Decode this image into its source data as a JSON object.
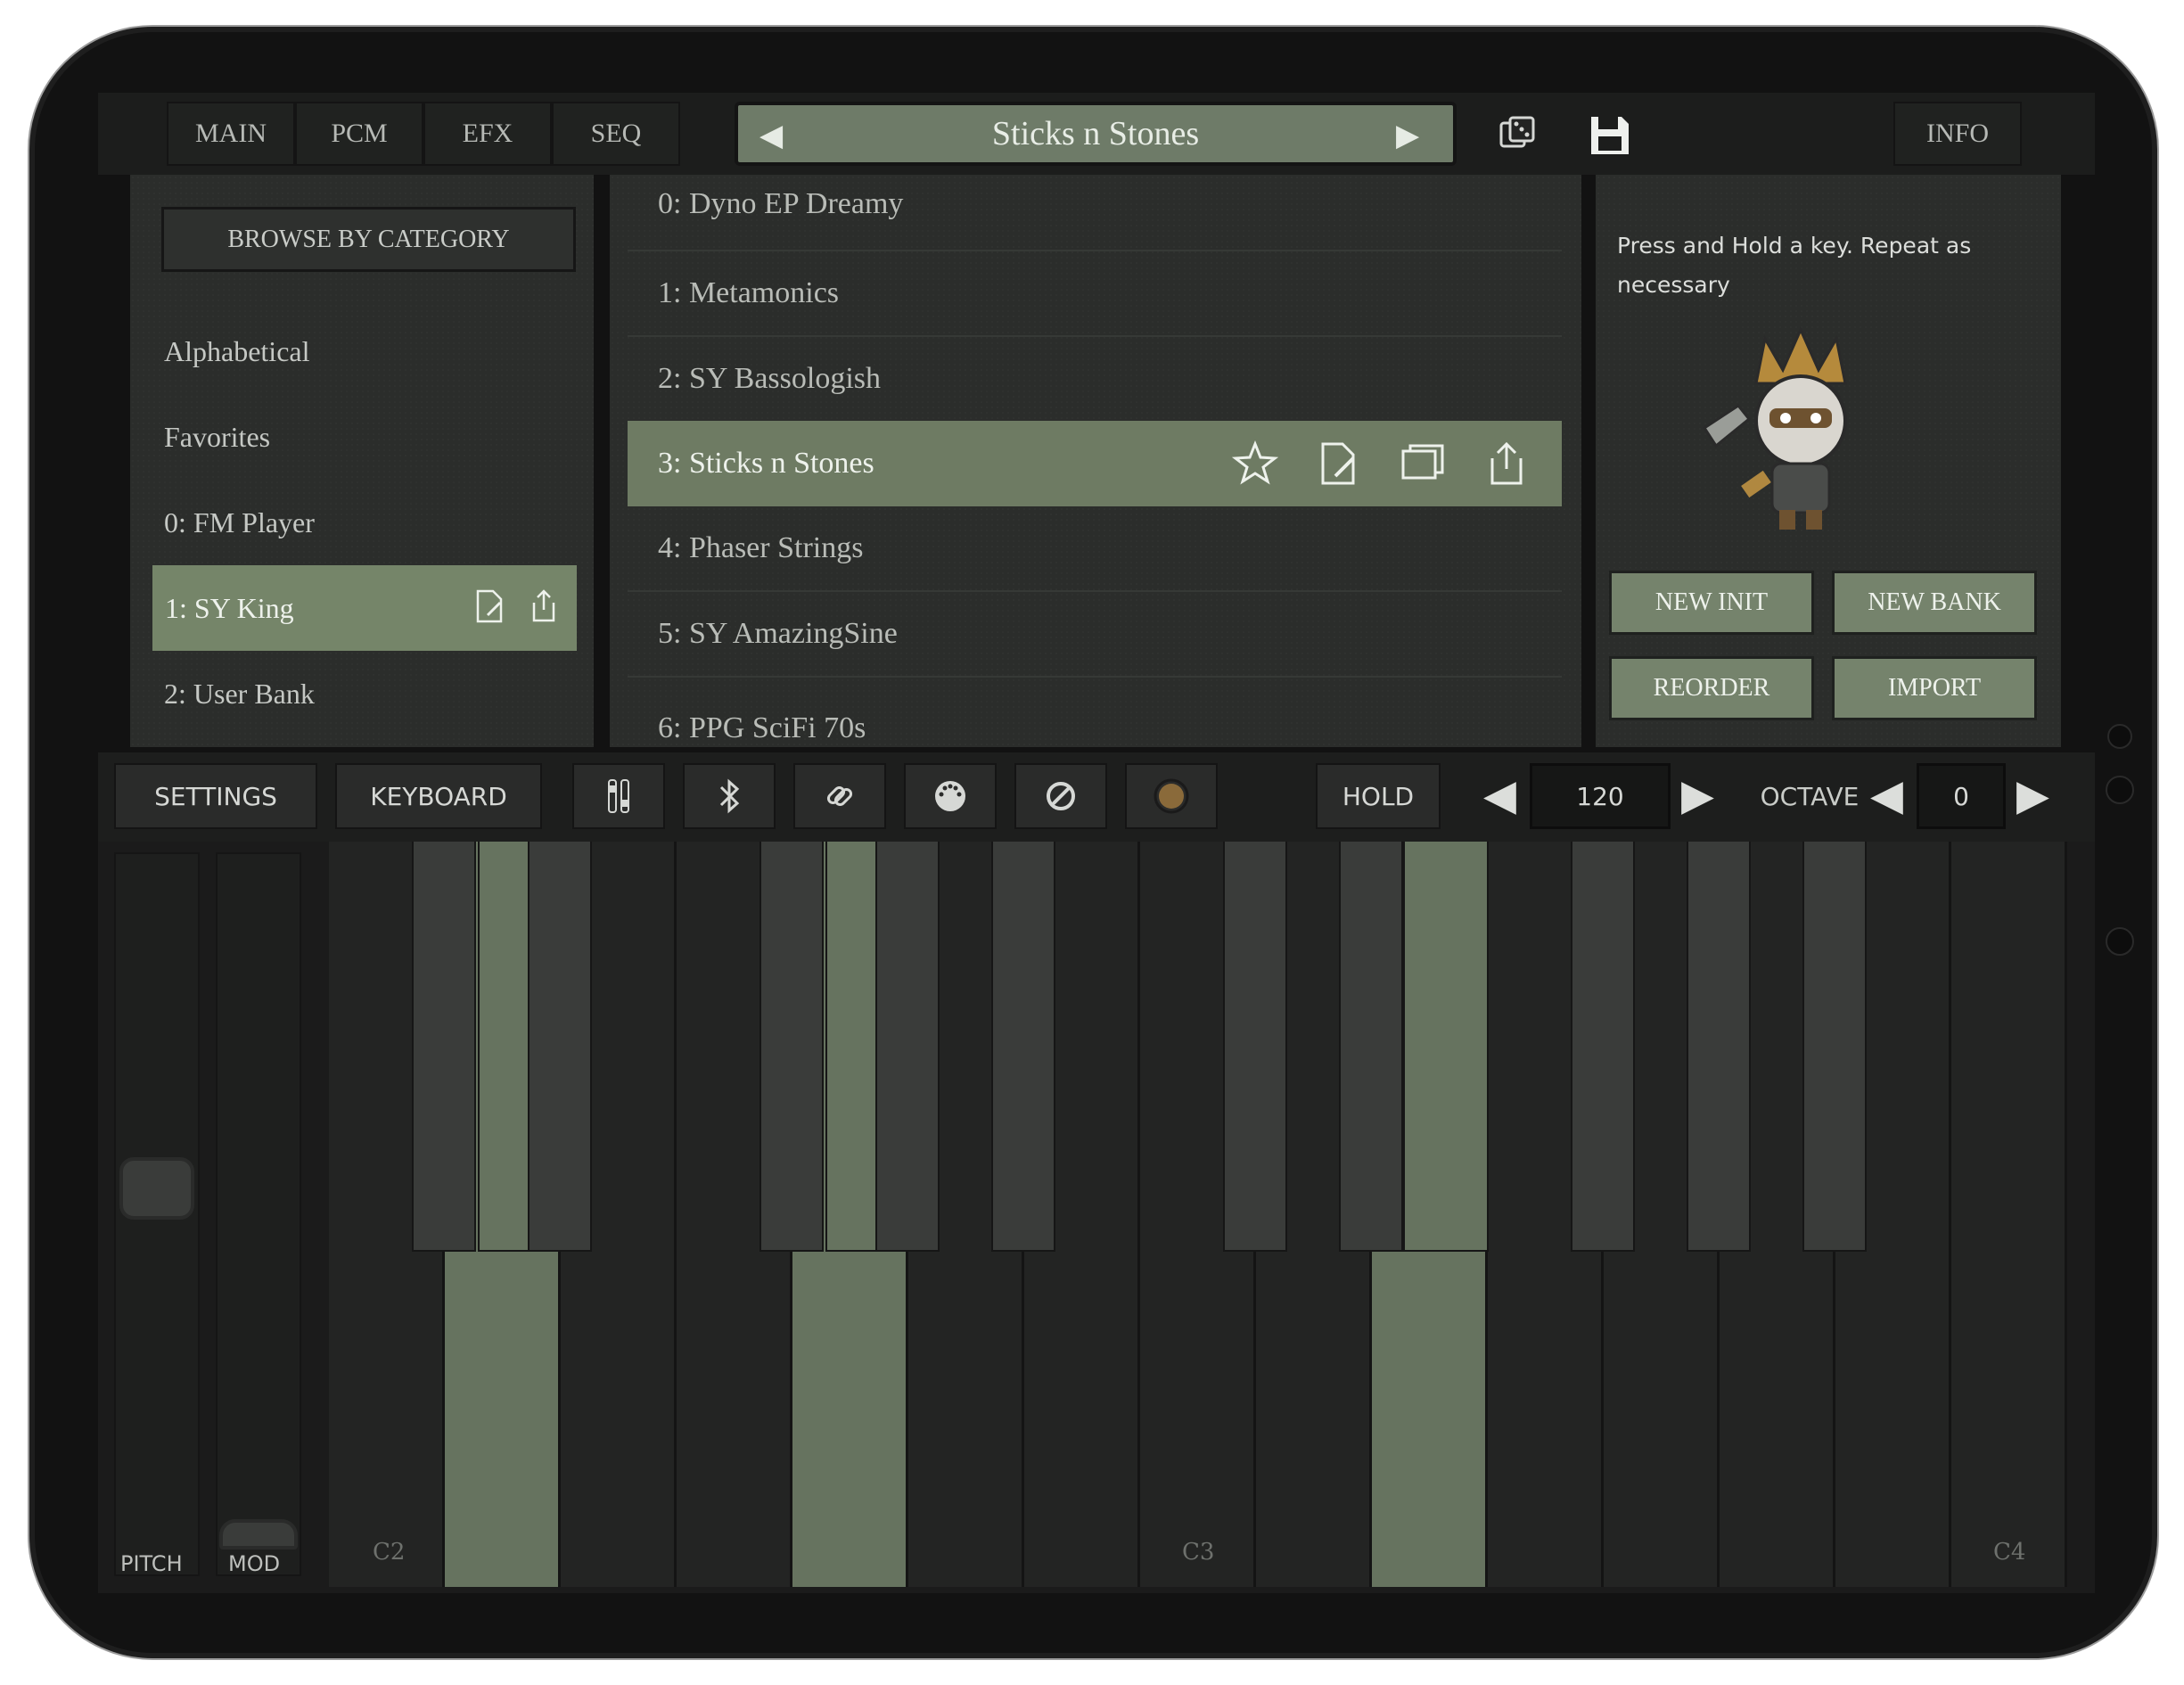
{
  "tabs": [
    "MAIN",
    "PCM",
    "EFX",
    "SEQ"
  ],
  "preset_name": "Sticks n Stones",
  "info_label": "INFO",
  "browse_button": "BROWSE BY CATEGORY",
  "categories": [
    "Alphabetical",
    "Favorites",
    "0: FM Player",
    "1: SY King",
    "2: User Bank"
  ],
  "presets": [
    "0: Dyno EP Dreamy",
    "1: Metamonics",
    "2: SY Bassologish",
    "3: Sticks n Stones",
    "4: Phaser Strings",
    "5: SY AmazingSine",
    "6: PPG SciFi 70s"
  ],
  "hint": "Press and Hold a key. Repeat as necessary",
  "actions": {
    "new_init": "NEW INIT",
    "new_bank": "NEW BANK",
    "reorder": "REORDER",
    "import": "IMPORT"
  },
  "toolbar": {
    "settings": "SETTINGS",
    "keyboard": "KEYBOARD",
    "hold": "HOLD",
    "tempo": "120",
    "octave_label": "OCTAVE",
    "octave": "0"
  },
  "wheels": {
    "pitch": "PITCH",
    "mod": "MOD"
  },
  "notes": {
    "c2": "C2",
    "c3": "C3",
    "c4": "C4"
  },
  "colors": {
    "accent": "#6e7b63",
    "panel": "#2b2d2b",
    "device": "#121212"
  }
}
